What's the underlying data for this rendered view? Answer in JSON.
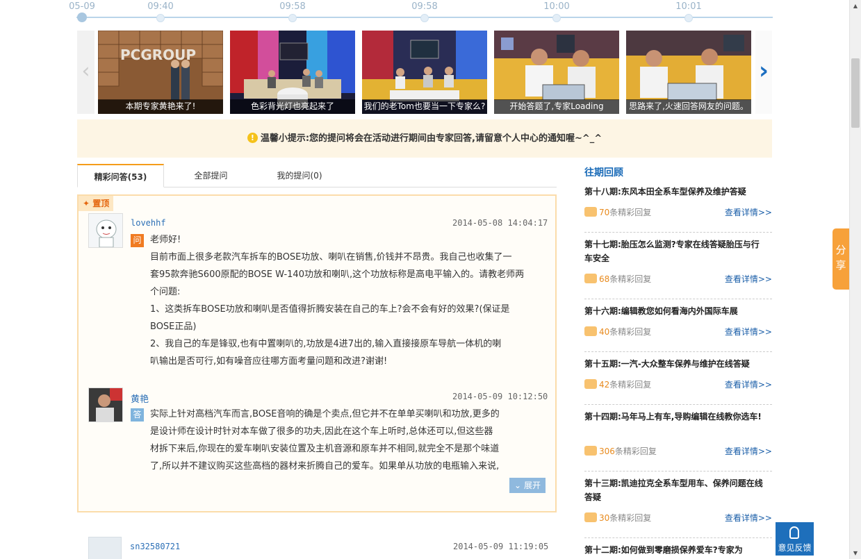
{
  "timeline": {
    "times": [
      "05-09",
      "09:40",
      "09:58",
      "09:58",
      "10:00",
      "10:01"
    ]
  },
  "carousel": {
    "slides": [
      {
        "caption": "本期专家黄艳来了!",
        "sign": "PCGROUP"
      },
      {
        "caption": "色彩背光灯也亮起来了"
      },
      {
        "caption": "我们的老Tom也要当一下专家么?"
      },
      {
        "caption": "开始答题了,专家Loading"
      },
      {
        "caption": "思路来了,火速回答网友的问题。"
      }
    ],
    "prev_icon": "chevron-left-icon",
    "next_icon": "chevron-right-icon"
  },
  "tip": {
    "icon": "!",
    "text": "温馨小提示:您的提问将会在活动进行期间由专家回答,请留意个人中心的通知喔~^_^"
  },
  "tabs": [
    {
      "label": "精彩问答(53)",
      "active": true
    },
    {
      "label": "全部提问",
      "active": false
    },
    {
      "label": "我的提问(0)",
      "active": false
    }
  ],
  "pinned": {
    "badge": "置顶",
    "question": {
      "user": "lovehhf",
      "time": "2014-05-08 14:04:17",
      "badge": "问",
      "lines": [
        "老师好!",
        "目前市面上很多老款汽车拆车的BOSE功放、喇叭在销售,价钱并不昂贵。我自己也收集了一",
        "套95款奔驰S600原配的BOSE W-140功放和喇叭,这个功放标称是高电平输入的。请教老师两",
        "个问题:",
        "1、这类拆车BOSE功放和喇叭是否值得折腾安装在自己的车上?会不会有好的效果?(保证是",
        "BOSE正品)",
        "2、我自己的车是锋驭,也有中置喇叭的,功放是4进7出的,输入直接接原车导航一体机的喇",
        "叭输出是否可行,如有噪音应往哪方面考量问题和改进?谢谢!"
      ]
    },
    "answer": {
      "user": "黄艳",
      "time": "2014-05-09 10:12:50",
      "badge": "答",
      "lines": [
        "实际上针对高档汽车而言,BOSE音响的确是个卖点,但它并不在单单买喇叭和功放,更多的",
        "是设计师在设计时针对本车做了很多的功夫,因此在这个车上听时,总体还可以,但这些器",
        "材拆下来后,你现在的爱车喇叭安装位置及主机音源和原车并不相同,就完全不是那个味道",
        "了,所以并不建议购买这些高档的器材来折腾自己的爱车。如果单从功放的电瓶输入来说,"
      ],
      "expand_label": "展开"
    }
  },
  "second_post": {
    "user": "sn32580721",
    "time": "2014-05-09 11:19:05"
  },
  "review": {
    "title": "往期回顾",
    "items": [
      {
        "title": "第十八期:东风本田全系车型保养及维护答疑",
        "count": "70",
        "suffix": "条精彩回复",
        "more": "查看详情>>"
      },
      {
        "title": "第十七期:胎压怎么监测?专家在线答疑胎压与行车安全",
        "count": "68",
        "suffix": "条精彩回复",
        "more": "查看详情>>"
      },
      {
        "title": "第十六期:编辑教您如何看海内外国际车展",
        "count": "40",
        "suffix": "条精彩回复",
        "more": "查看详情>>"
      },
      {
        "title": "第十五期:一汽-大众整车保养与维护在线答疑",
        "count": "42",
        "suffix": "条精彩回复",
        "more": "查看详情>>"
      },
      {
        "title": "第十四期:马年马上有车,导购编辑在线教你选车!",
        "count": "306",
        "suffix": "条精彩回复",
        "more": "查看详情>>"
      },
      {
        "title": "第十三期:凯迪拉克全系车型用车、保养问题在线答疑",
        "count": "30",
        "suffix": "条精彩回复",
        "more": "查看详情>>"
      },
      {
        "title": "第十二期:如何做到零磨损保养爱车?专家为"
      }
    ]
  },
  "share": {
    "label_1": "分",
    "label_2": "享"
  },
  "feedback": {
    "label": "意见反馈"
  },
  "colors": {
    "accent_orange": "#f59c1a",
    "link_blue": "#1a6bb8",
    "tip_bg": "#fdf5e4"
  }
}
